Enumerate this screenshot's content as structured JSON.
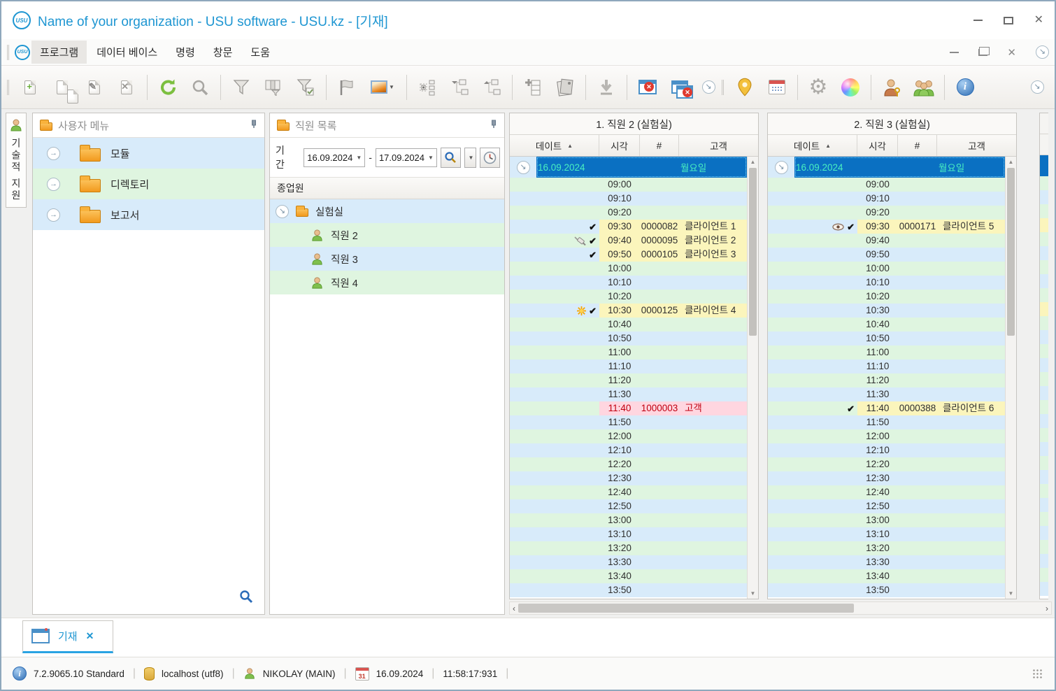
{
  "window": {
    "title": "Name of your organization - USU software - USU.kz - [기재]"
  },
  "menu": {
    "items": [
      "프로그램",
      "데이터 베이스",
      "명령",
      "창문",
      "도움"
    ]
  },
  "toolbar": {
    "icons": [
      "new-record",
      "copy-record",
      "edit-record",
      "delete-record",
      "refresh",
      "search",
      "filter",
      "filter-window",
      "filter-apply",
      "flag",
      "image-mode",
      "row-settings",
      "collapse-tree",
      "expand-tree",
      "add-row",
      "reports",
      "import",
      "close-window",
      "close-all-windows",
      "overflow",
      "location",
      "calendar",
      "settings",
      "colors",
      "user-permissions",
      "employees",
      "about",
      "overflow-more"
    ]
  },
  "side_tab": {
    "label": "기술적 지원"
  },
  "user_menu_panel": {
    "title": "사용자 메뉴",
    "items": [
      {
        "label": "모듈"
      },
      {
        "label": "디렉토리"
      },
      {
        "label": "보고서"
      }
    ]
  },
  "employee_panel": {
    "title": "직원 목록",
    "period_label": "기간",
    "date_from": "16.09.2024",
    "date_to": "17.09.2024",
    "column_header": "종업원",
    "group": {
      "label": "실험실"
    },
    "employees": [
      {
        "label": "직원 2"
      },
      {
        "label": "직원 3"
      },
      {
        "label": "직원 4"
      }
    ]
  },
  "schedule": {
    "headers": [
      "데이트",
      "시각",
      "#",
      "고객"
    ],
    "times": [
      "09:00",
      "09:10",
      "09:20",
      "09:30",
      "09:40",
      "09:50",
      "10:00",
      "10:10",
      "10:20",
      "10:30",
      "10:40",
      "10:50",
      "11:00",
      "11:10",
      "11:20",
      "11:30",
      "11:40",
      "11:50",
      "12:00",
      "12:10",
      "12:20",
      "12:30",
      "12:40",
      "12:50",
      "13:00",
      "13:10",
      "13:20",
      "13:30",
      "13:40",
      "13:50"
    ],
    "columns": [
      {
        "title": "1. 직원 2 (실험실)",
        "date": "16.09.2024",
        "weekday": "월요일",
        "appointments": [
          {
            "time": "09:30",
            "number": "0000082",
            "client": "클라이언트 1",
            "icons": [
              "check"
            ],
            "highlight": "yellow"
          },
          {
            "time": "09:40",
            "number": "0000095",
            "client": "클라이언트 2",
            "icons": [
              "syringe",
              "check"
            ],
            "highlight": "yellow"
          },
          {
            "time": "09:50",
            "number": "0000105",
            "client": "클라이언트 3",
            "icons": [
              "check"
            ],
            "highlight": "yellow"
          },
          {
            "time": "10:30",
            "number": "0000125",
            "client": "클라이언트 4",
            "icons": [
              "sun",
              "check"
            ],
            "highlight": "yellow"
          },
          {
            "time": "11:40",
            "number": "1000003",
            "client": "고객",
            "icons": [],
            "highlight": "pink"
          }
        ]
      },
      {
        "title": "2. 직원 3 (실험실)",
        "date": "16.09.2024",
        "weekday": "월요일",
        "appointments": [
          {
            "time": "09:30",
            "number": "0000171",
            "client": "클라이언트 5",
            "icons": [
              "eye",
              "check"
            ],
            "highlight": "yellow"
          },
          {
            "time": "11:40",
            "number": "0000388",
            "client": "클라이언트 6",
            "icons": [
              "check"
            ],
            "highlight": "yellow"
          }
        ]
      }
    ],
    "partial_column": {
      "highlight_times": [
        "09:30",
        "10:30"
      ]
    }
  },
  "tabbar": {
    "tabs": [
      {
        "label": "기재"
      }
    ]
  },
  "statusbar": {
    "version": "7.2.9065.10 Standard",
    "host": "localhost (utf8)",
    "user": "NIKOLAY (MAIN)",
    "date": "16.09.2024",
    "time": "11:58:17:931"
  },
  "colors": {
    "accent_blue": "#1E96D2",
    "selected_row": "#0A70C2",
    "selected_text": "#49EFC0",
    "row_blue": "#D8EBFA",
    "row_green": "#DFF5E0",
    "highlight_yellow": "#FBF5BC",
    "highlight_pink": "#FFD6E0",
    "highlight_pink_text": "#C00010"
  }
}
